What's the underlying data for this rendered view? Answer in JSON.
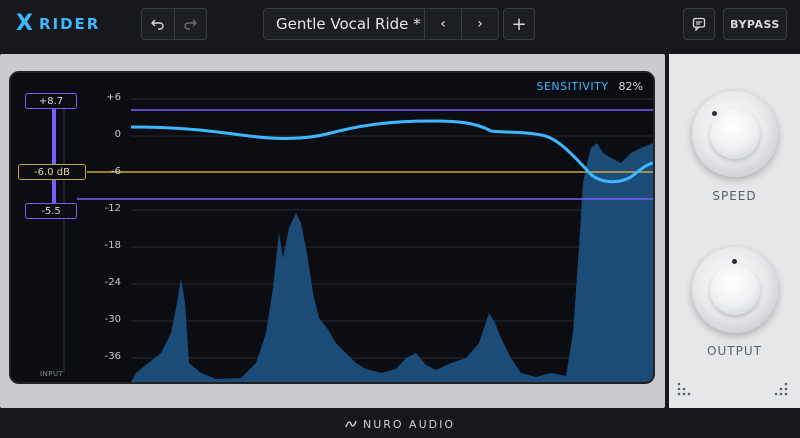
{
  "app": {
    "logo_icon": "X",
    "logo_text": "RIDER",
    "brand_color": "#3db8ff"
  },
  "toolbar": {
    "undo_icon": "undo-icon",
    "redo_icon": "redo-icon",
    "preset_name": "Gentle Vocal Ride *",
    "prev_label": "‹",
    "next_label": "›",
    "add_label": "+",
    "bypass_label": "BYPASS"
  },
  "display": {
    "sensitivity_label": "SENSITIVITY",
    "sensitivity_value": "82%",
    "db_scale": [
      "+6",
      "0",
      "-6",
      "-12",
      "-18",
      "-24",
      "-30",
      "-36"
    ],
    "range_top_value": "+8.7",
    "range_bottom_value": "-5.5",
    "target_value": "-6.0 dB",
    "input_label": "INPUT"
  },
  "controls": {
    "speed_label": "SPEED",
    "output_label": "OUTPUT"
  },
  "footer": {
    "brand": "NURO AUDIO"
  },
  "colors": {
    "accent": "#3db8ff",
    "purple": "#7b5cff",
    "target_yellow": "#d6b63a",
    "spectrum": "#1d4f7a"
  }
}
